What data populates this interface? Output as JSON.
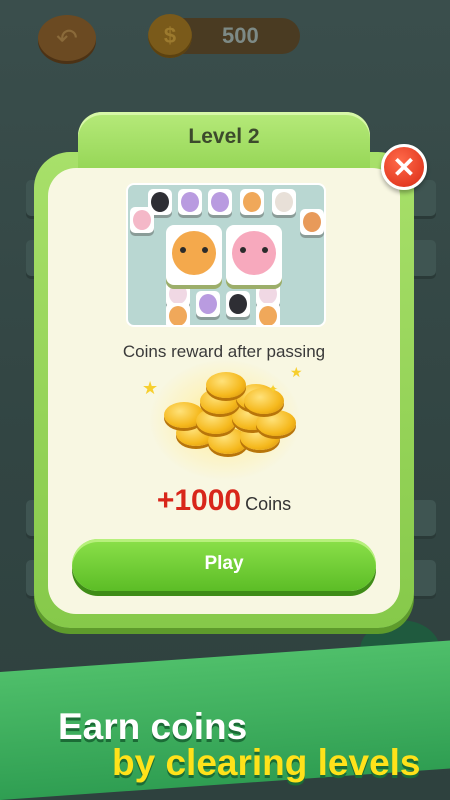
{
  "top_bar": {
    "back_icon": "undo-arrow-icon",
    "coin_icon": "dollar-coin-icon",
    "coin_balance": "500"
  },
  "dialog": {
    "title": "Level 2",
    "close_icon": "close-icon",
    "reward_caption": "Coins reward after passing",
    "reward_amount": "+1000",
    "reward_unit": "Coins",
    "play_label": "Play"
  },
  "banner": {
    "line1": "Earn coins",
    "line2": "by clearing levels"
  },
  "colors": {
    "dialog_green": "#8fd24f",
    "play_green": "#5cbd26",
    "close_red": "#e53d24",
    "reward_red": "#d8261a",
    "banner_yellow": "#ffe21a"
  }
}
